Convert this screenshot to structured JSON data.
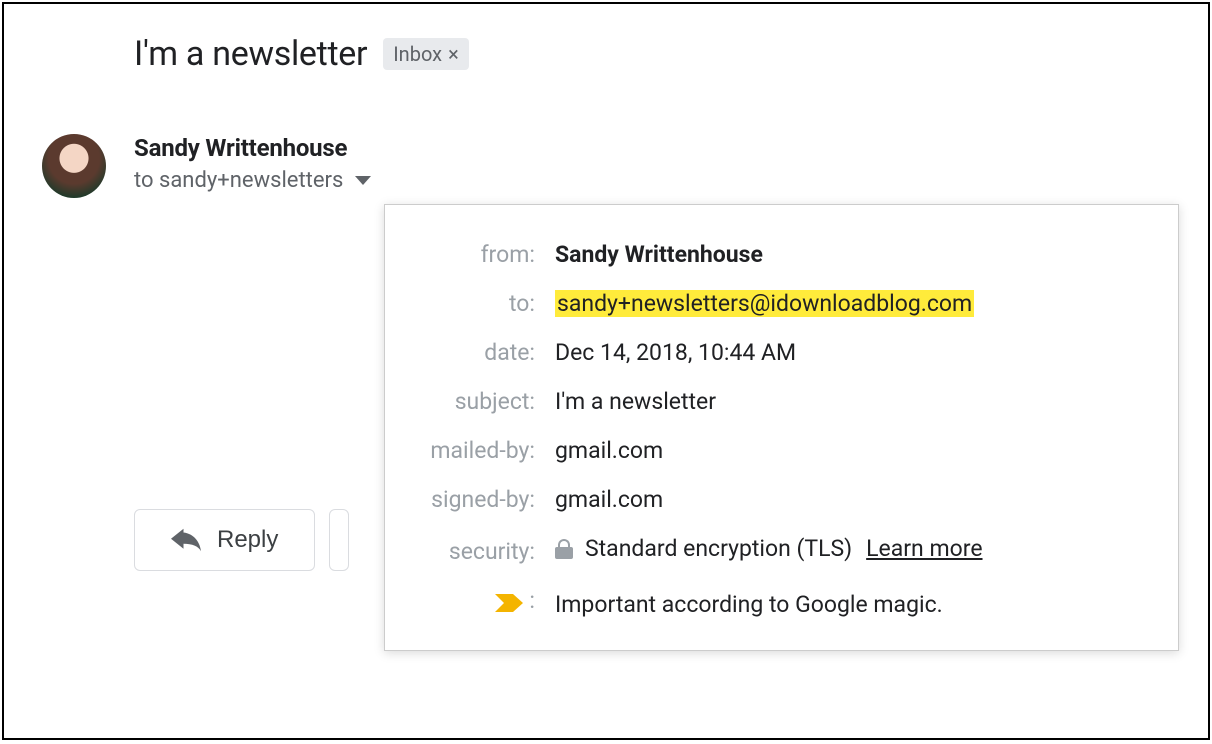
{
  "subject": "I'm a newsletter",
  "label_chip": "Inbox",
  "sender": {
    "name": "Sandy Writtenhouse",
    "recipient_summary": "to sandy+newsletters"
  },
  "actions": {
    "reply": "Reply"
  },
  "details": {
    "labels": {
      "from": "from:",
      "to": "to:",
      "date": "date:",
      "subject": "subject:",
      "mailed_by": "mailed-by:",
      "signed_by": "signed-by:",
      "security": "security:",
      "importance_colon": ":"
    },
    "from": "Sandy Writtenhouse",
    "to": "sandy+newsletters@idownloadblog.com",
    "date": "Dec 14, 2018, 10:44 AM",
    "subject": "I'm a newsletter",
    "mailed_by": "gmail.com",
    "signed_by": "gmail.com",
    "security": "Standard encryption (TLS)",
    "security_learn_more": "Learn more",
    "importance": "Important according to Google magic."
  }
}
